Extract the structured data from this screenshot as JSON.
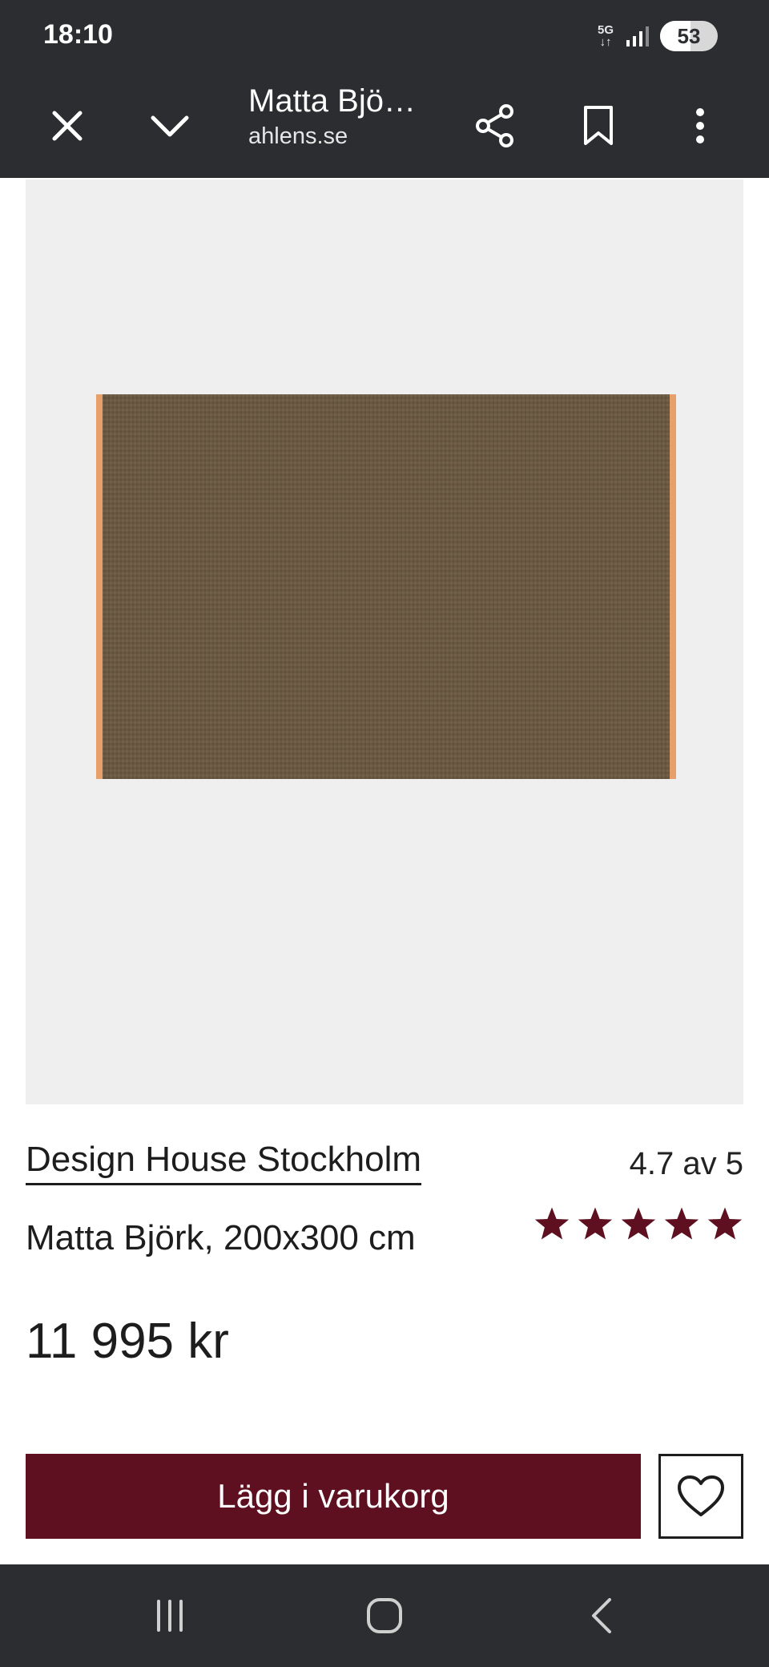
{
  "status_bar": {
    "time": "18:10",
    "network": "5G",
    "battery_percent": "53",
    "battery_level": 0.53
  },
  "browser": {
    "page_title": "Matta Bjö…",
    "domain": "ahlens.se",
    "icons": [
      "close-icon",
      "chevron-down-icon",
      "share-icon",
      "bookmark-icon",
      "more-vert-icon"
    ]
  },
  "product": {
    "brand": "Design House Stockholm",
    "name": "Matta Björk, 200x300 cm",
    "price": "11 995 kr",
    "rating_text": "4.7 av 5",
    "rating_value": 4.7,
    "rating_max": 5,
    "star_count": 5
  },
  "actions": {
    "add_to_cart_label": "Lägg i varukorg",
    "wishlist_icon": "heart-icon"
  },
  "nav": {
    "icons": [
      "recents-icon",
      "home-icon",
      "back-icon"
    ]
  },
  "colors": {
    "bars": "#2b2d31",
    "accent": "#5e1020",
    "star": "#5e1020",
    "image_bg": "#efefef",
    "rug": "#6a5840",
    "rug_edge": "#e8a06a"
  }
}
